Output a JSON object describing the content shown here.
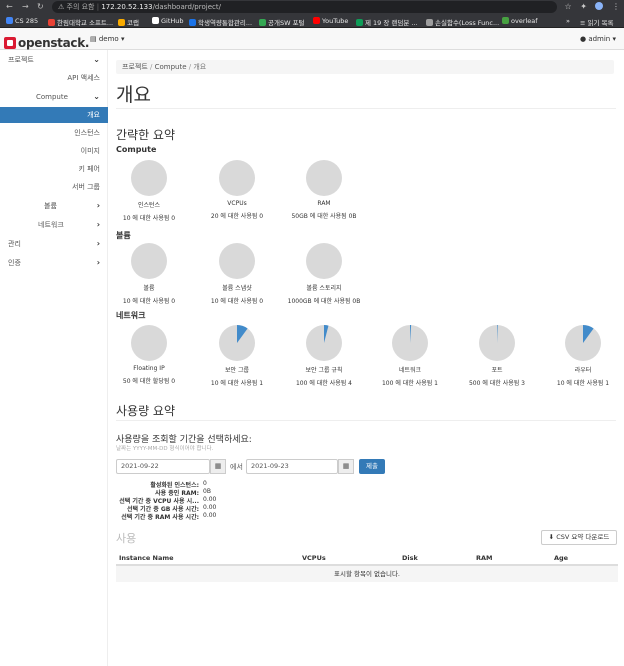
{
  "browser": {
    "security": "주의 요함",
    "url_host": "172.20.52.133",
    "url_path": "/dashboard/project/",
    "bookmarks": [
      {
        "label": "CS 285",
        "color": "#4285f4"
      },
      {
        "label": "한림대학교 소프트...",
        "color": "#e94235"
      },
      {
        "label": "코랩",
        "color": "#f9ab00"
      },
      {
        "label": "GitHub",
        "color": "#ffffff"
      },
      {
        "label": "학생역량통합관리...",
        "color": "#1a73e8"
      },
      {
        "label": "공개SW 포털",
        "color": "#34a853"
      },
      {
        "label": "YouTube",
        "color": "#ff0000"
      },
      {
        "label": "제 19 장 랜덤분 ...",
        "color": "#0f9d58"
      },
      {
        "label": "손실함수(Loss Func...",
        "color": "#9e9e9e"
      },
      {
        "label": "overleaf",
        "color": "#47a141"
      }
    ],
    "reading_list": "읽기 목록"
  },
  "topnav": {
    "logo": "openstack.",
    "project": "demo",
    "user": "admin"
  },
  "sidebar": {
    "items": [
      {
        "label": "프로젝트"
      },
      {
        "label": "API 액세스"
      },
      {
        "label": "Compute"
      },
      {
        "label": "개요"
      },
      {
        "label": "인스턴스"
      },
      {
        "label": "이미지"
      },
      {
        "label": "키 페어"
      },
      {
        "label": "서버 그룹"
      },
      {
        "label": "볼륨"
      },
      {
        "label": "네트워크"
      },
      {
        "label": "관리"
      },
      {
        "label": "인증"
      }
    ]
  },
  "main": {
    "breadcrumb": {
      "b1": "프로젝트",
      "b2": "Compute",
      "b3": "개요"
    },
    "title": "개요",
    "limit_summary": "간략한 요약",
    "compute_heading": "Compute",
    "volume_heading": "볼륨",
    "network_heading": "네트워크",
    "compute": [
      {
        "title": "인스턴스",
        "usage": "10 에 대한 사용됨 0",
        "fraction": 0
      },
      {
        "title": "VCPUs",
        "usage": "20 에 대한 사용됨 0",
        "fraction": 0
      },
      {
        "title": "RAM",
        "usage": "50GB 에 대한 사용됨 0B",
        "fraction": 0
      }
    ],
    "volume": [
      {
        "title": "볼륨",
        "usage": "10 에 대한 사용됨 0",
        "fraction": 0
      },
      {
        "title": "볼륨 스냅샷",
        "usage": "10 에 대한 사용됨 0",
        "fraction": 0
      },
      {
        "title": "볼륨 스토리지",
        "usage": "1000GB 에 대한 사용됨 0B",
        "fraction": 0
      }
    ],
    "network": [
      {
        "title": "Floating IP",
        "usage": "50 에 대한 할당됨 0",
        "fraction": 0
      },
      {
        "title": "보안 그룹",
        "usage": "10 에 대한 사용됨 1",
        "fraction": 0.1
      },
      {
        "title": "보안 그룹 규칙",
        "usage": "100 에 대한 사용됨 4",
        "fraction": 0.04
      },
      {
        "title": "네트워크",
        "usage": "100 에 대한 사용됨 1",
        "fraction": 0.01
      },
      {
        "title": "포트",
        "usage": "500 에 대한 사용됨 3",
        "fraction": 0.006
      },
      {
        "title": "라우터",
        "usage": "10 에 대한 사용됨 1",
        "fraction": 0.1
      }
    ],
    "usage_summary": "사용량 요약",
    "period_label": "사용량을 조회할 기간을 선택하세요:",
    "period_hint": "날짜는 YYYY-MM-DD 형식이어야 합니다.",
    "start_date": "2021-09-22",
    "to_label": "에서",
    "end_date": "2021-09-23",
    "submit": "제출",
    "summary": [
      {
        "label": "활성화된 인스턴스:",
        "value": "0"
      },
      {
        "label": "사용 중인 RAM:",
        "value": "0B"
      },
      {
        "label": "선택 기간 중 VCPU 사용 시...",
        "value": "0.00"
      },
      {
        "label": "선택 기간 중 GB 사용 시간:",
        "value": "0.00"
      },
      {
        "label": "선택 기간 중 RAM 사용 시간:",
        "value": "0.00"
      }
    ],
    "usage_title": "사용",
    "csv_button": "CSV 요약 다운로드",
    "table": {
      "columns": [
        "Instance Name",
        "VCPUs",
        "Disk",
        "RAM",
        "Age"
      ],
      "empty": "표시할 항목이 없습니다."
    }
  },
  "colors": {
    "pie_bg": "#d9d9d9",
    "pie_fill": "#428bca",
    "active": "#337ab7"
  }
}
